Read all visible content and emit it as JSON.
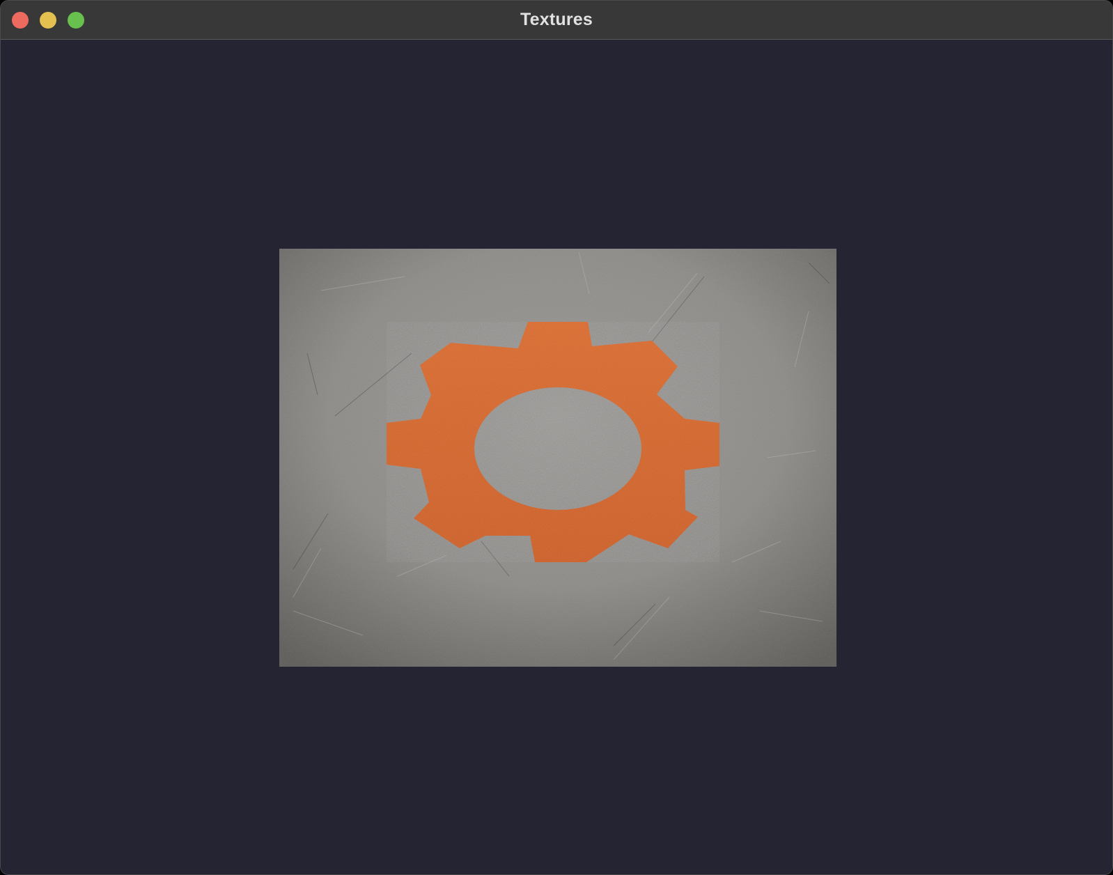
{
  "window": {
    "title": "Textures",
    "controls": [
      {
        "name": "close",
        "color": "#ed6a5e"
      },
      {
        "name": "minimize",
        "color": "#e3c04f"
      },
      {
        "name": "maximize",
        "color": "#68c04f"
      }
    ]
  },
  "colors": {
    "titlebar": "#383838",
    "viewport_background": "#242432",
    "texture_background": "#8f8d8a",
    "gear": "#d9672c"
  },
  "texture": {
    "subject": "gear-icon"
  }
}
